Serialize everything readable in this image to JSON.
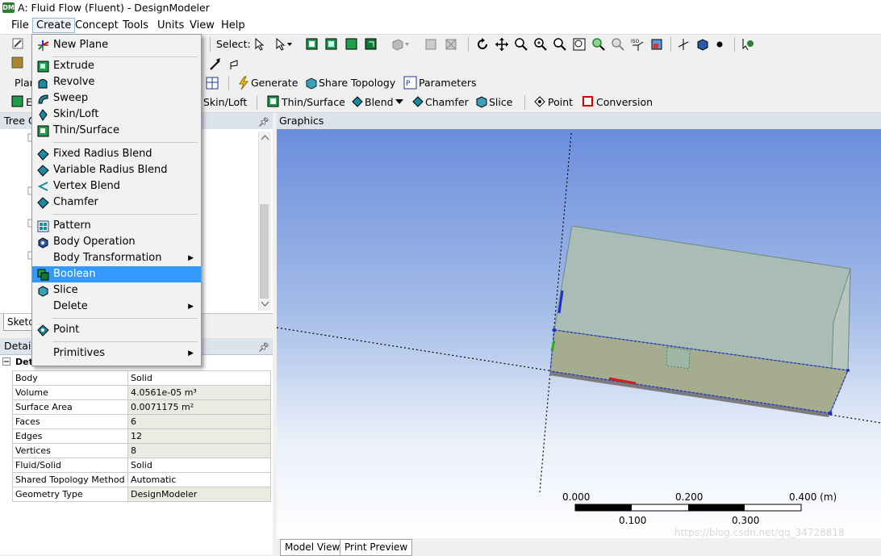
{
  "window": {
    "title": "A: Fluid Flow (Fluent) - DesignModeler",
    "app_icon_text": "DM"
  },
  "menubar": [
    "File",
    "Create",
    "Concept",
    "Tools",
    "Units",
    "View",
    "Help"
  ],
  "toolbar1": {
    "select_label": "Select:"
  },
  "toolbar3": {
    "plane_label": "Plan",
    "generate": "Generate",
    "share_topology": "Share Topology",
    "parameters": "Parameters"
  },
  "toolbar4": {
    "extrude_short": "E",
    "skin_loft": "Skin/Loft",
    "thin_surface": "Thin/Surface",
    "blend": "Blend",
    "chamfer": "Chamfer",
    "slice": "Slice",
    "point": "Point",
    "conversion": "Conversion"
  },
  "tree_panel": {
    "title": "Tree O",
    "tab": "Sketc"
  },
  "details_panel": {
    "title": "Details",
    "section": "Details of Body",
    "rows": [
      {
        "k": "Body",
        "v": "Solid"
      },
      {
        "k": "Volume",
        "v": "4.0561e-05 m³"
      },
      {
        "k": "Surface Area",
        "v": "0.0071175 m²"
      },
      {
        "k": "Faces",
        "v": "6"
      },
      {
        "k": "Edges",
        "v": "12"
      },
      {
        "k": "Vertices",
        "v": "8"
      },
      {
        "k": "Fluid/Solid",
        "v": "Solid"
      },
      {
        "k": "Shared Topology Method",
        "v": "Automatic"
      },
      {
        "k": "Geometry Type",
        "v": "DesignModeler"
      }
    ]
  },
  "graphics": {
    "title": "Graphics",
    "scale_top": [
      "0.000",
      "0.200",
      "0.400 (m)"
    ],
    "scale_bottom": [
      "0.100",
      "0.300"
    ],
    "watermark": "https://blog.csdn.net/qq_34728818"
  },
  "tabs": [
    "Model View",
    "Print Preview"
  ],
  "create_menu": {
    "items": [
      {
        "label": "New Plane"
      },
      {
        "label": "Extrude"
      },
      {
        "label": "Revolve"
      },
      {
        "label": "Sweep"
      },
      {
        "label": "Skin/Loft"
      },
      {
        "label": "Thin/Surface"
      },
      {
        "label": "Fixed Radius Blend"
      },
      {
        "label": "Variable Radius Blend"
      },
      {
        "label": "Vertex Blend"
      },
      {
        "label": "Chamfer"
      },
      {
        "label": "Pattern"
      },
      {
        "label": "Body Operation"
      },
      {
        "label": "Body Transformation"
      },
      {
        "label": "Boolean"
      },
      {
        "label": "Slice"
      },
      {
        "label": "Delete"
      },
      {
        "label": "Point"
      },
      {
        "label": "Primitives"
      }
    ]
  },
  "colors": {
    "highlight": "#3399ff",
    "graphics_top": "#6b8ddc",
    "body_face": "#9fb3a9",
    "edge_blue": "#1a2fd1"
  }
}
